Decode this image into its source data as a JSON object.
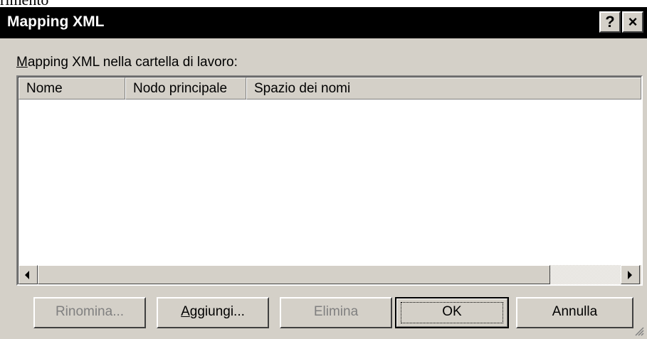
{
  "above_text": "rimento",
  "window": {
    "title": "Mapping XML",
    "help_label": "?",
    "close_label": "×"
  },
  "section_label": {
    "mnemonic": "M",
    "rest": "apping XML nella cartella di lavoro:"
  },
  "table": {
    "columns": [
      "Nome",
      "Nodo principale",
      "Spazio dei nomi"
    ],
    "rows": []
  },
  "buttons": {
    "rename": "Rinomina...",
    "add_mnemonic": "A",
    "add_rest": "ggiungi...",
    "delete": "Elimina",
    "ok": "OK",
    "cancel": "Annulla"
  },
  "icons": {
    "scroll_left": "left-arrow-icon",
    "scroll_right": "right-arrow-icon",
    "resize": "resize-grip-icon"
  }
}
